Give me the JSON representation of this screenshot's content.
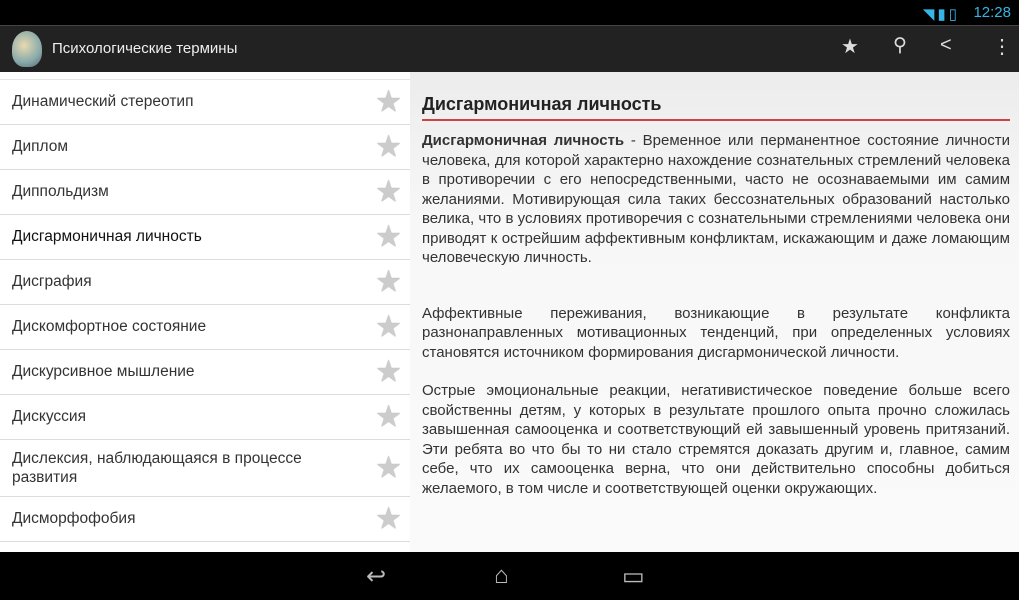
{
  "status": {
    "time": "12:28"
  },
  "appbar": {
    "title": "Психологические термины",
    "actions": [
      "favorite",
      "search",
      "share",
      "overflow"
    ]
  },
  "list": {
    "items": [
      {
        "label": "Динамический стереотип"
      },
      {
        "label": "Диплом"
      },
      {
        "label": "Диппольдизм"
      },
      {
        "label": "Дисгармоничная личность",
        "selected": true
      },
      {
        "label": "Дисграфия"
      },
      {
        "label": "Дискомфортное состояние"
      },
      {
        "label": "Дискурсивное мышление"
      },
      {
        "label": "Дискуссия"
      },
      {
        "label": "Дислексия, наблюдающаяся в процессе развития"
      },
      {
        "label": "Дисморфофобия"
      }
    ]
  },
  "article": {
    "title": "Дисгармоничная личность",
    "term": "Дисгармоничная личность",
    "p1": " - Временное или перманентное состояние личности человека, для которой характерно нахождение сознательных стремлений человека в противоречии с его непосредственными, часто не осознаваемыми им самим желаниями. Мотивирующая сила таких бессознательных образований настолько велика, что в условиях противоречия с сознательными стремлениями человека они приводят к острейшим аффективным конфликтам, искажающим и даже ломающим человеческую личность.",
    "p2": "Аффективные переживания, возникающие в результате конфликта разнонаправленных мотивационных тенденций, при определенных условиях становятся источником формирования дисгармонической личности.",
    "p3": "Острые эмоциональные реакции, негативистическое поведение больше всего свойственны детям, у которых в результате прошлого опыта прочно сложилась завышенная самооценка и соответствующий ей завышенный уровень притязаний. Эти ребята во что бы то ни стало стремятся доказать другим и, главное, самим себе, что их самооценка верна, что они действительно способны добиться желаемого, в том числе и соответствующей оценки окружающих."
  },
  "colors": {
    "accent": "#cc4444",
    "actionbar": "#222222",
    "status_icons": "#33b5e5"
  }
}
